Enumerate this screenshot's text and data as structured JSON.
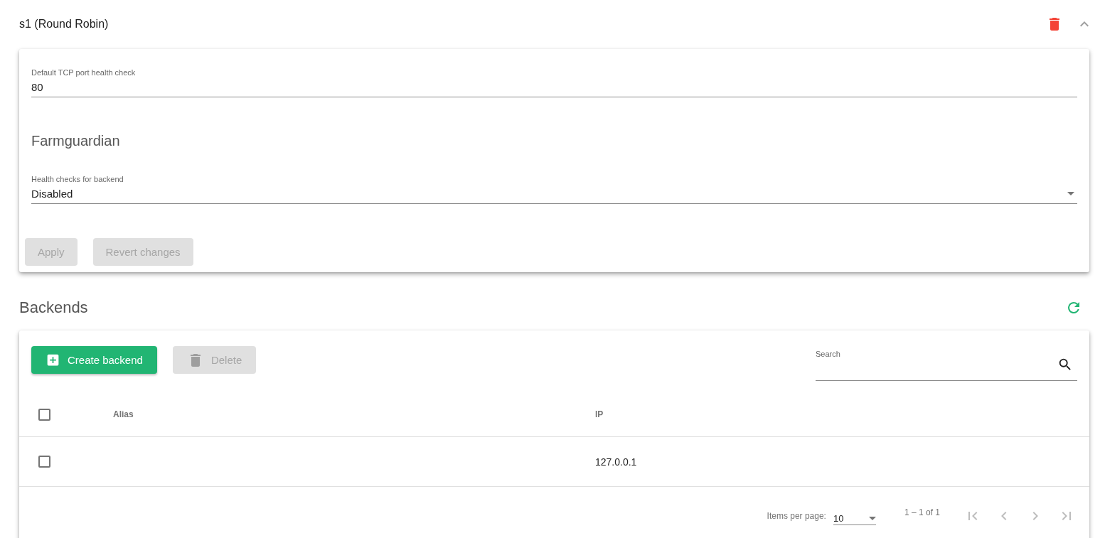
{
  "service": {
    "title": "s1 (Round Robin)",
    "expanded": true
  },
  "settings": {
    "port_field": {
      "label": "Default TCP port health check",
      "value": "80"
    },
    "section_title": "Farmguardian",
    "health_select": {
      "label": "Health checks for backend",
      "value": "Disabled"
    },
    "buttons": [
      {
        "label": "Apply",
        "disabled": true
      },
      {
        "label": "Revert changes",
        "disabled": true
      }
    ]
  },
  "backends": {
    "title": "Backends",
    "toolbar": [
      {
        "label": "Create backend",
        "kind": "create",
        "disabled": false
      },
      {
        "label": "Delete",
        "kind": "delete",
        "disabled": true
      }
    ],
    "search": {
      "label": "Search"
    },
    "table": {
      "columns": [
        "Alias",
        "IP"
      ],
      "header_checked": false,
      "rows": [
        {
          "ip": "127.0.0.1",
          "checked": false
        }
      ]
    },
    "paginator": {
      "label": "Items per page:",
      "page_size": "10",
      "range": "1 – 1 of 1",
      "nav": [
        {
          "kind": "first",
          "disabled": true
        },
        {
          "kind": "previous",
          "disabled": true
        },
        {
          "kind": "next",
          "disabled": true
        },
        {
          "kind": "last",
          "disabled": true
        }
      ]
    }
  }
}
